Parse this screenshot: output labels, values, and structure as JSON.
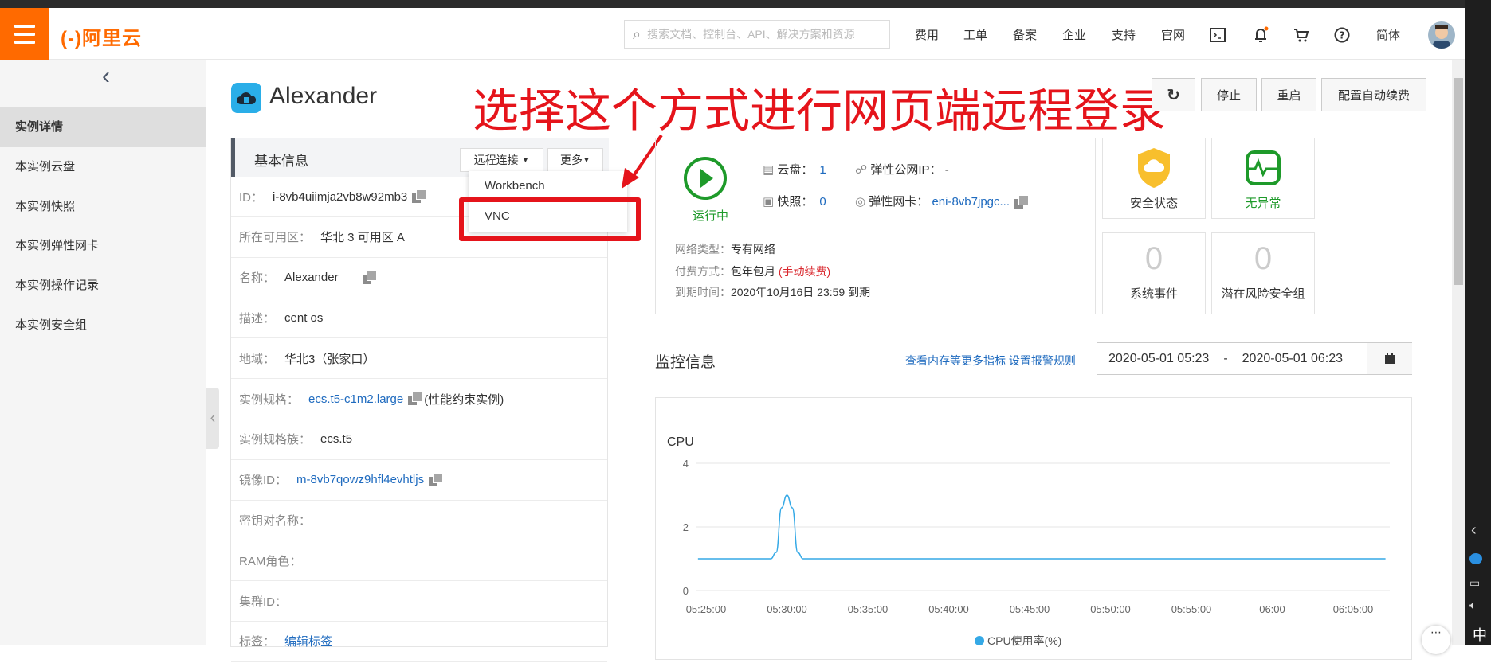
{
  "header": {
    "logo": "(-)阿里云",
    "search_placeholder": "搜索文档、控制台、API、解决方案和资源",
    "nav": [
      "费用",
      "工单",
      "备案",
      "企业",
      "支持",
      "官网"
    ],
    "language": "简体",
    "accent": "#ff6a00"
  },
  "sidebar": {
    "items": [
      "实例详情",
      "本实例云盘",
      "本实例快照",
      "本实例弹性网卡",
      "本实例操作记录",
      "本实例安全组"
    ]
  },
  "page": {
    "title": "Alexander",
    "annotation": "选择这个方式进行网页端远程登录",
    "buttons": {
      "stop": "停止",
      "restart": "重启",
      "auto_renew": "配置自动续费"
    }
  },
  "basic": {
    "title": "基本信息",
    "remote": "远程连接",
    "more": "更多",
    "dropdown": [
      "Workbench",
      "VNC"
    ],
    "rows": [
      {
        "k": "ID：",
        "v": "i-8vb4uiimja2vb8w92mb3",
        "copy": true
      },
      {
        "k": "所在可用区：",
        "v": "华北 3 可用区 A"
      },
      {
        "k": "名称：",
        "v": "Alexander",
        "copy": true
      },
      {
        "k": "描述：",
        "v": "cent os"
      },
      {
        "k": "地域：",
        "v": "华北3（张家口）"
      },
      {
        "k": "实例规格：",
        "v": "ecs.t5-c1m2.large",
        "link": true,
        "copy": true,
        "extra": "(性能约束实例)"
      },
      {
        "k": "实例规格族：",
        "v": "ecs.t5"
      },
      {
        "k": "镜像ID：",
        "v": "m-8vb7qowz9hfl4evhtljs",
        "link": true,
        "copy": true
      },
      {
        "k": "密钥对名称：",
        "v": ""
      },
      {
        "k": "RAM角色：",
        "v": ""
      },
      {
        "k": "集群ID：",
        "v": ""
      },
      {
        "k": "标签：",
        "v": "编辑标签",
        "link": true
      }
    ]
  },
  "status": {
    "state": "运行中",
    "disk_label": "云盘：",
    "disk": "1",
    "eip_label": "弹性公网IP：",
    "eip": "-",
    "snap_label": "快照：",
    "snap": "0",
    "eni_label": "弹性网卡：",
    "eni": "eni-8vb7jpgc...",
    "net_label": "网络类型：",
    "net": "专有网络",
    "pay_label": "付费方式：",
    "pay": "包年包月",
    "pay_note": "(手动续费)",
    "exp_label": "到期时间：",
    "exp": "2020年10月16日 23:59 到期"
  },
  "tiles": {
    "security": "安全状态",
    "health": "无异常",
    "events_count": "0",
    "events": "系统事件",
    "risk_count": "0",
    "risk": "潜在风险安全组"
  },
  "monitor": {
    "title": "监控信息",
    "link1": "查看内存等更多指标",
    "link2": "设置报警规则",
    "start": "2020-05-01 05:23",
    "sep": "-",
    "end": "2020-05-01 06:23"
  },
  "chart_data": {
    "type": "line",
    "title": "CPU",
    "legend": "CPU使用率(%)",
    "color": "#35a9e6",
    "yticks": [
      0,
      2,
      4
    ],
    "ylim": [
      0,
      4
    ],
    "xticks": [
      "05:25:00",
      "05:30:00",
      "05:35:00",
      "05:40:00",
      "05:45:00",
      "05:50:00",
      "05:55:00",
      "06:00",
      "06:05:00"
    ],
    "series": [
      {
        "name": "CPU使用率(%)",
        "x": [
          "05:24:30",
          "05:29:00",
          "05:29:20",
          "05:29:40",
          "05:30:00",
          "05:30:20",
          "05:30:40",
          "05:31:00",
          "06:07:00"
        ],
        "values": [
          1,
          1,
          1.2,
          2.6,
          3,
          2.6,
          1.2,
          1,
          1
        ]
      }
    ]
  }
}
